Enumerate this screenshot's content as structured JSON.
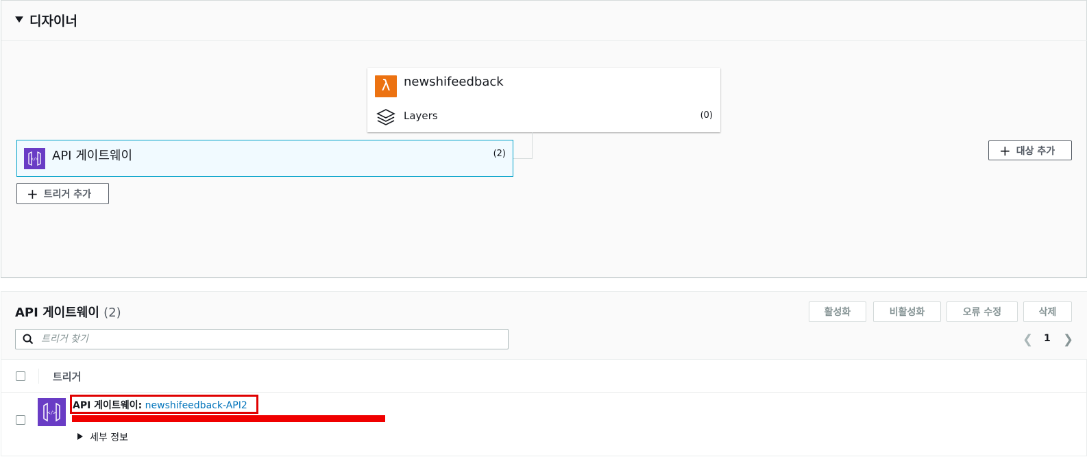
{
  "designer": {
    "title": "디자이너",
    "function": {
      "name": "newshifeedback",
      "icon": "lambda-icon"
    },
    "layers": {
      "label": "Layers",
      "count": "(0)",
      "icon": "layers-icon"
    },
    "trigger_card": {
      "name": "API 게이트웨이",
      "count": "(2)",
      "icon": "api-gateway-icon"
    },
    "add_trigger_label": "트리거 추가",
    "add_destination_label": "대상 추가"
  },
  "triggers": {
    "title": "API 게이트웨이",
    "count": "(2)",
    "actions": {
      "activate": "활성화",
      "deactivate": "비활성화",
      "fix_errors": "오류 수정",
      "delete": "삭제"
    },
    "search_placeholder": "트리거 찾기",
    "pagination": {
      "page": "1"
    },
    "column_header": "트리거",
    "rows": [
      {
        "type": "API 게이트웨이:",
        "link": "newshifeedback-API2",
        "details_label": "세부 정보",
        "redacted": true
      }
    ]
  },
  "colors": {
    "lambda": "#ec7211",
    "api_gateway": "#693cc5",
    "highlight": "#e00000",
    "link": "#0073bb",
    "trigger_selected_border": "#00a1c9"
  }
}
